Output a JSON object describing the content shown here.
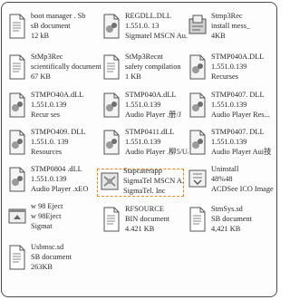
{
  "files": [
    {
      "icon": "text-document-icon",
      "lines": [
        "boot manager . Sb",
        "sB document",
        "12 kB"
      ]
    },
    {
      "icon": "dll-file-icon",
      "lines": [
        "REGDLL.DLL",
        "1.551.0. 13",
        "Sigmatel MSCN Au."
      ]
    },
    {
      "icon": "setup-package-icon",
      "lines": [
        "Stmp3Rec",
        "install mess_",
        "4KB"
      ]
    },
    {
      "icon": "text-document-icon",
      "lines": [
        "StMp3Rec",
        "scientifically document",
        "67 KB"
      ]
    },
    {
      "icon": "text-document-icon",
      "lines": [
        "StMp3Recnt",
        "safety compilation",
        "1 KB"
      ]
    },
    {
      "icon": "dll-file-icon",
      "lines": [
        "STMP040A.DLL",
        "1.551.0.139",
        "Recurses"
      ]
    },
    {
      "icon": "dll-file-icon",
      "lines": [
        "STMPO40A.dLL",
        "1.551.0.139",
        "Recur ses"
      ]
    },
    {
      "icon": "dll-file-icon",
      "lines": [
        "STMP040A.dLL",
        "1.551.0.139",
        "Audio Player .册/J"
      ]
    },
    {
      "icon": "dll-file-icon",
      "lines": [
        "STMP0407. DLL",
        "1.551.0.139",
        "Audio Player Res..."
      ]
    },
    {
      "icon": "dll-file-icon",
      "lines": [
        "STMPO409. DLL",
        "1.551.0. 139",
        "Resources"
      ]
    },
    {
      "icon": "dll-file-icon",
      "lines": [
        "STMP0411.dLL",
        "1.551.0.139",
        "Audio Player .柳5/U/J"
      ]
    },
    {
      "icon": "dll-file-icon",
      "lines": [
        "STMP0407. DLL",
        "1.551.0.139",
        "Audio Player Aui技"
      ]
    },
    {
      "icon": "dll-file-icon",
      "lines": [
        "STMP0804 .dLL",
        "1.551.0.139",
        "Audio Player .xEO"
      ]
    },
    {
      "icon": "application-icon",
      "lines": [
        "Stapcaterapp",
        "SigmaTel MSCN A...",
        "SigmaTel. Inc"
      ]
    },
    {
      "icon": "uninstall-image-icon",
      "lines": [
        "Uninstall",
        "48%48",
        "ACDSee ICO Image"
      ]
    },
    {
      "icon": "executable-icon",
      "lines": [
        "w 98 Eject",
        "w 98Eject",
        "Sigmat"
      ]
    },
    {
      "icon": "binary-file-icon",
      "lines": [
        "RFSOURCE",
        "BIN document",
        "4.421 KB"
      ]
    },
    {
      "icon": "text-document-icon",
      "lines": [
        "StmSys.sd",
        "SB document",
        "4,421 KB"
      ]
    },
    {
      "icon": "text-document-icon",
      "lines": [
        "Usbmsc.sd",
        "SB document",
        "263KB"
      ]
    }
  ]
}
